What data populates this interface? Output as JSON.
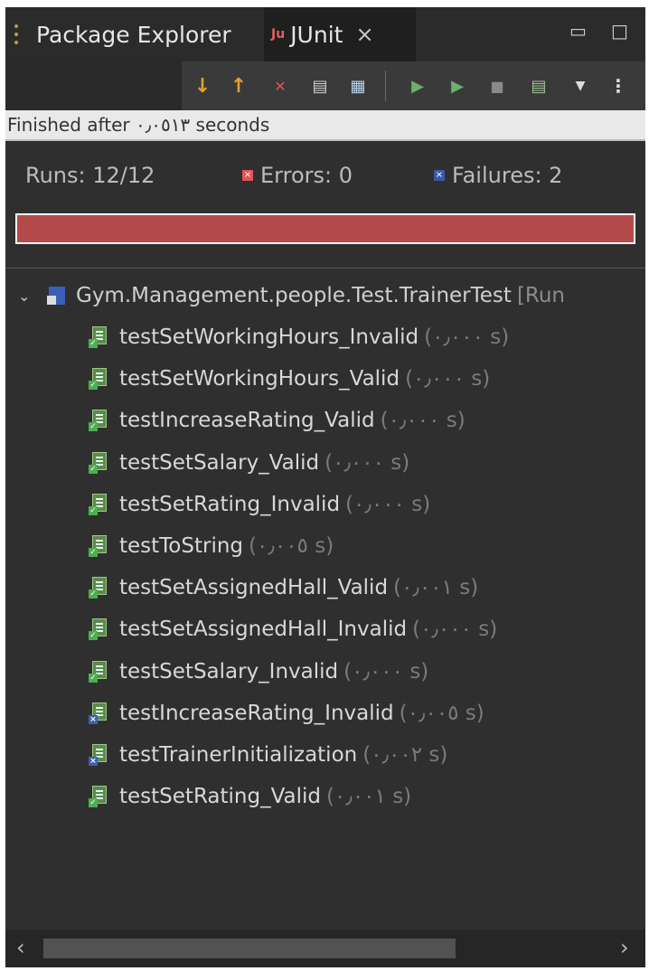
{
  "tabs": {
    "package_explorer": "Package Explorer",
    "junit": "JUnit"
  },
  "status": "Finished after ٠٫٠٥١٣ seconds",
  "counters": {
    "runs": "Runs:  12/12",
    "errors": "Errors:  0",
    "failures": "Failures:  2"
  },
  "progress": {
    "fraction": 1.0,
    "color": "#b44a4a"
  },
  "tree": {
    "root": "Gym.Management.people.Test.TrainerTest",
    "root_runner": "[Run",
    "items": [
      {
        "name": "testSetWorkingHours_Invalid",
        "time": "(٠٫٠٠٠ s)",
        "status": "pass"
      },
      {
        "name": "testSetWorkingHours_Valid",
        "time": "(٠٫٠٠٠ s)",
        "status": "pass"
      },
      {
        "name": "testIncreaseRating_Valid",
        "time": "(٠٫٠٠٠ s)",
        "status": "pass"
      },
      {
        "name": "testSetSalary_Valid",
        "time": "(٠٫٠٠٠ s)",
        "status": "pass"
      },
      {
        "name": "testSetRating_Invalid",
        "time": "(٠٫٠٠٠ s)",
        "status": "pass"
      },
      {
        "name": "testToString",
        "time": "(٠٫٠٠٥ s)",
        "status": "pass"
      },
      {
        "name": "testSetAssignedHall_Valid",
        "time": "(٠٫٠٠١ s)",
        "status": "pass"
      },
      {
        "name": "testSetAssignedHall_Invalid",
        "time": "(٠٫٠٠٠ s)",
        "status": "pass"
      },
      {
        "name": "testSetSalary_Invalid",
        "time": "(٠٫٠٠٠ s)",
        "status": "pass"
      },
      {
        "name": "testIncreaseRating_Invalid",
        "time": "(٠٫٠٠٥ s)",
        "status": "fail"
      },
      {
        "name": "testTrainerInitialization",
        "time": "(٠٫٠٠٢ s)",
        "status": "fail"
      },
      {
        "name": "testSetRating_Valid",
        "time": "(٠٫٠٠١ s)",
        "status": "pass"
      }
    ]
  },
  "icons": {
    "toolbar": [
      "next-failure-icon",
      "previous-failure-icon",
      "show-failures-only-icon",
      "scroll-lock-icon",
      "history-icon",
      "rerun-icon",
      "rerun-failed-icon",
      "stop-icon",
      "layout-icon",
      "dropdown-icon",
      "view-menu-icon"
    ]
  }
}
